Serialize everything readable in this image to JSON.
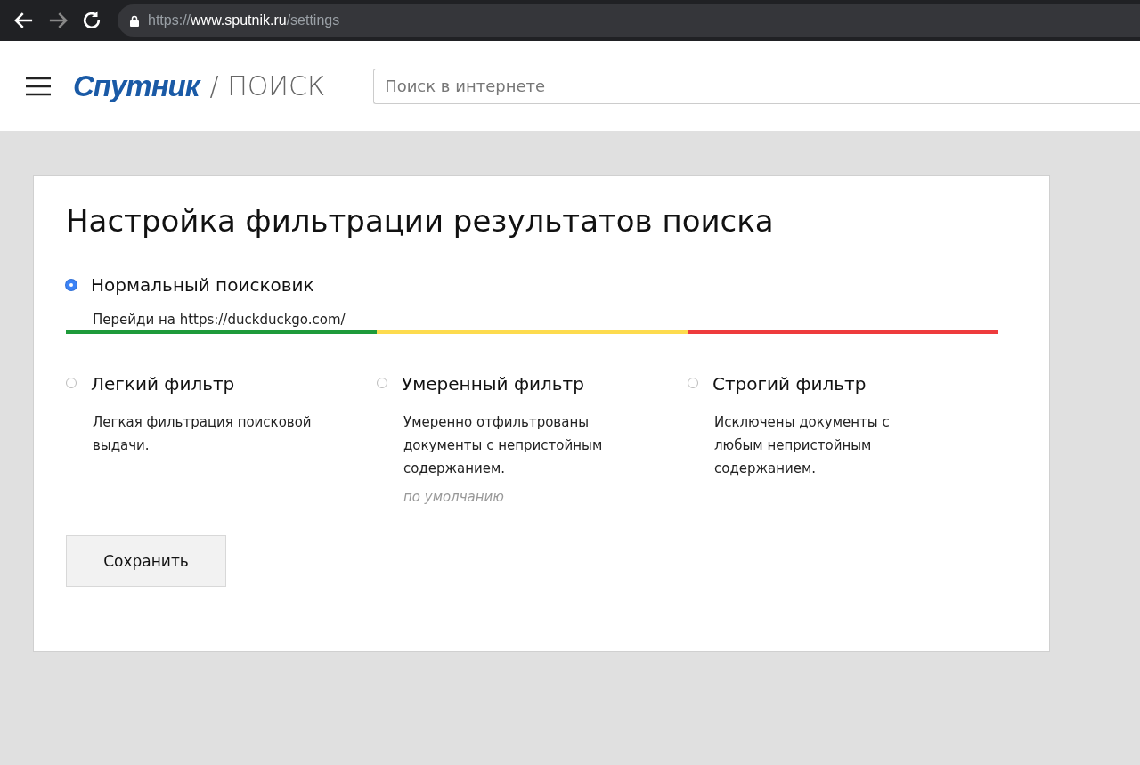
{
  "browser": {
    "url_scheme": "https://",
    "url_host": "www.sputnik.ru",
    "url_path": "/settings"
  },
  "header": {
    "logo": "Спутник",
    "section": "/ ПОИСК",
    "search": {
      "placeholder": "Поиск в интернете"
    }
  },
  "settings": {
    "title": "Настройка фильтрации результатов поиска",
    "normal": {
      "label": "Нормальный поисковик",
      "selected": true,
      "hint": "Перейди на https://duckduckgo.com/"
    },
    "filters": [
      {
        "label": "Легкий фильтр",
        "selected": false,
        "color": "#1e9a3a",
        "description": "Легкая фильтрация поисковой выдачи."
      },
      {
        "label": "Умеренный фильтр",
        "selected": false,
        "color": "#fddb4e",
        "description": "Умеренно отфильтрованы документы с непристойным содержанием.",
        "note": "по умолчанию"
      },
      {
        "label": "Строгий фильтр",
        "selected": false,
        "color": "#ee3b3d",
        "description": "Исключены документы с любым непристойным содержанием."
      }
    ],
    "save_button": "Сохранить"
  }
}
